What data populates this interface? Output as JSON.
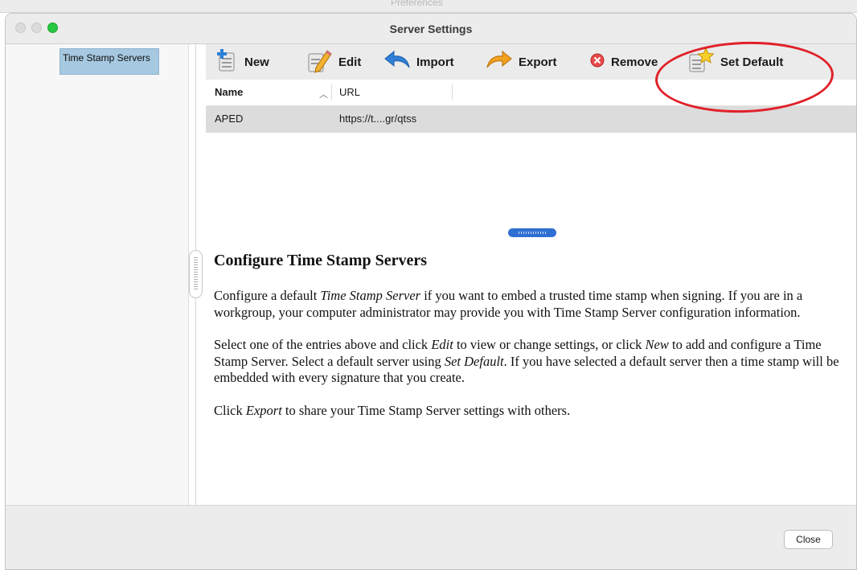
{
  "background_window": {
    "title": "Preferences"
  },
  "window": {
    "title": "Server Settings"
  },
  "sidebar": {
    "items": [
      {
        "label": "Time Stamp Servers",
        "selected": true
      }
    ]
  },
  "toolbar": {
    "new_label": "New",
    "edit_label": "Edit",
    "import_label": "Import",
    "export_label": "Export",
    "remove_label": "Remove",
    "set_default_label": "Set Default"
  },
  "table": {
    "columns": [
      {
        "label": "Name",
        "sort": "ascending"
      },
      {
        "label": "URL"
      }
    ],
    "rows": [
      {
        "name": "APED",
        "url": "https://t....gr/qtss"
      }
    ]
  },
  "help": {
    "heading": "Configure Time Stamp Servers",
    "p1": {
      "a": "Configure a default ",
      "b": "Time Stamp Server",
      "c": " if you want to embed a trusted time stamp when signing. If you are in a workgroup, your computer administrator may provide you with Time Stamp Server configuration information."
    },
    "p2": {
      "a": "Select one of the entries above and click ",
      "b": "Edit",
      "c": " to view or change settings, or click ",
      "d": "New",
      "e": " to add and configure a Time Stamp Server. Select a default server using ",
      "f": "Set Default",
      "g": ". If you have selected a default server then a time stamp will be embedded with every signature that you create."
    },
    "p3": {
      "a": "Click ",
      "b": "Export",
      "c": " to share your Time Stamp Server settings with others."
    }
  },
  "footer": {
    "close_label": "Close"
  },
  "colors": {
    "annotation": "#e0212a",
    "selection": "#a6c8e0",
    "splitter": "#2f6fd3",
    "zoom_button": "#28c840"
  }
}
